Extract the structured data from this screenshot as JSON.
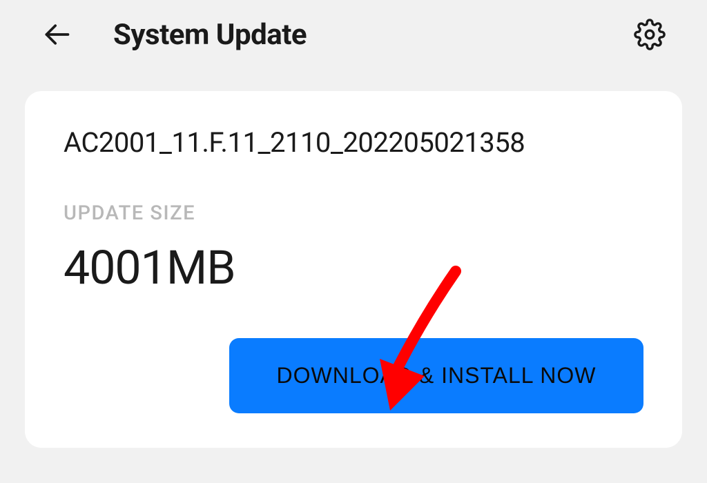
{
  "header": {
    "title": "System Update"
  },
  "update": {
    "version": "AC2001_11.F.11_2110_202205021358",
    "size_label": "UPDATE SIZE",
    "size_value": "4001MB",
    "download_button_label": "DOWNLOAD & INSTALL NOW"
  }
}
